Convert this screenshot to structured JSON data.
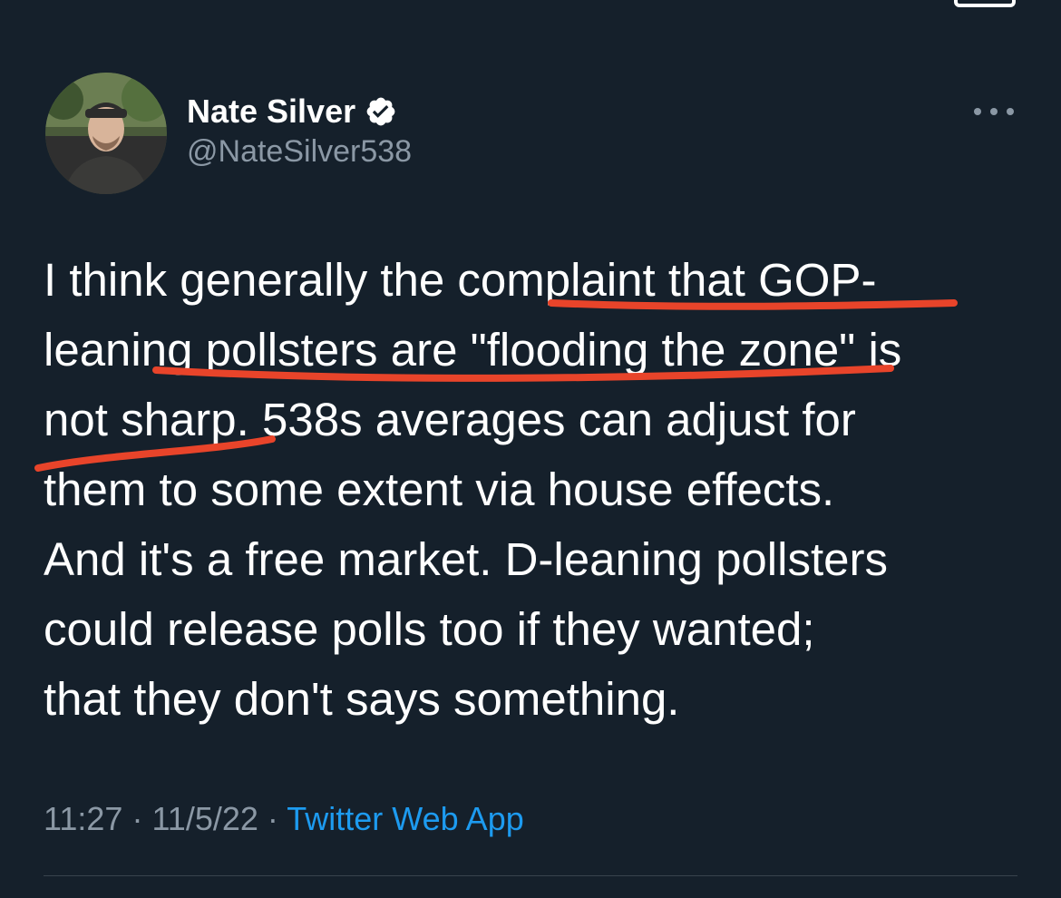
{
  "tweet": {
    "author": {
      "display_name": "Nate Silver",
      "handle": "@NateSilver538",
      "verified": true,
      "avatar_icon": "profile-photo"
    },
    "more_icon": "ellipsis-icon",
    "text_lines": [
      "I think generally the complaint that GOP-",
      "leaning pollsters are \"flooding the zone\" is",
      "not sharp. 538s averages can adjust for",
      "them to some extent via house effects.",
      "And it's a free market. D-leaning pollsters",
      "could release polls too if they wanted;",
      "that they don't says something."
    ],
    "time": "11:27",
    "separator": "·",
    "date": "11/5/22",
    "source": "Twitter Web App"
  },
  "colors": {
    "background": "#15202b",
    "text": "#ffffff",
    "secondary_text": "#8b98a5",
    "link": "#1d9bf0",
    "underline_annotation": "#e8442a"
  }
}
